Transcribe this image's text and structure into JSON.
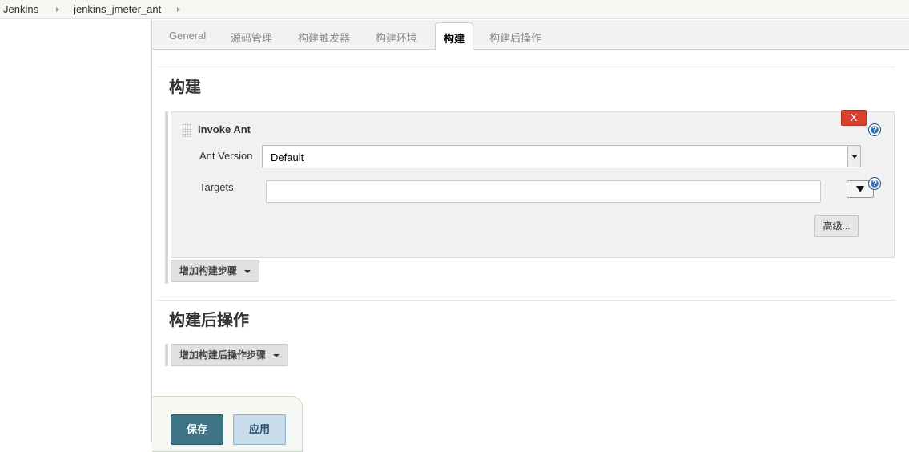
{
  "breadcrumb": {
    "items": [
      "Jenkins",
      "jenkins_jmeter_ant"
    ]
  },
  "tabs": [
    {
      "label": "General"
    },
    {
      "label": "源码管理"
    },
    {
      "label": "构建触发器"
    },
    {
      "label": "构建环境"
    },
    {
      "label": "构建"
    },
    {
      "label": "构建后操作"
    }
  ],
  "active_tab": "构建",
  "build_section": {
    "title": "构建",
    "step": {
      "title": "Invoke Ant",
      "delete_label": "X",
      "ant_version_label": "Ant Version",
      "ant_version_value": "Default",
      "targets_label": "Targets",
      "targets_value": "",
      "advanced_label": "高级..."
    },
    "add_step_label": "增加构建步骤"
  },
  "post_build_section": {
    "title": "构建后操作",
    "add_post_step_label": "增加构建后操作步骤"
  },
  "footer": {
    "save_label": "保存",
    "apply_label": "应用"
  },
  "icons": {
    "help": "help-icon",
    "separator": "chevron-right-icon",
    "grip": "drag-handle-icon"
  },
  "colors": {
    "delete": "#d9412f",
    "save": "#3d7587",
    "apply": "#c9dcec",
    "help": "#2f6fad"
  }
}
